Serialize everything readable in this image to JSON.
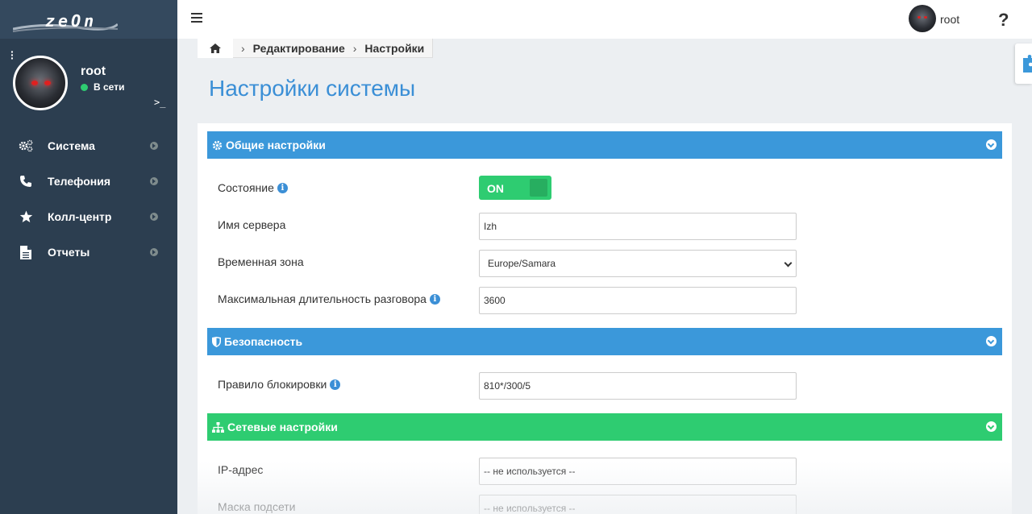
{
  "sidebar": {
    "logo_text": "zeOn",
    "user": {
      "name": "root",
      "status": "В сети"
    },
    "terminal_glyph": ">_",
    "items": [
      {
        "label": "Система",
        "icon": "gears-icon"
      },
      {
        "label": "Телефония",
        "icon": "phone-icon"
      },
      {
        "label": "Колл-центр",
        "icon": "star-icon"
      },
      {
        "label": "Отчеты",
        "icon": "document-icon"
      }
    ]
  },
  "topbar": {
    "user_name": "root",
    "help": "?"
  },
  "breadcrumb": {
    "items": [
      "Редактирование",
      "Настройки"
    ]
  },
  "page": {
    "title": "Настройки системы"
  },
  "sections": {
    "general": {
      "title": "Общие настройки",
      "state_label": "Состояние",
      "state_value": "ON",
      "server_name_label": "Имя сервера",
      "server_name_value": "Izh",
      "timezone_label": "Временная зона",
      "timezone_value": "Europe/Samara",
      "max_duration_label": "Максимальная длительность разговора",
      "max_duration_value": "3600"
    },
    "security": {
      "title": "Безопасность",
      "block_rule_label": "Правило блокировки",
      "block_rule_value": "810*/300/5"
    },
    "network": {
      "title": "Сетевые настройки",
      "ip_label": "IP-адрес",
      "ip_value": "-- не используется --",
      "mask_label": "Маска подсети",
      "mask_value": "-- не используется --"
    }
  },
  "colors": {
    "sidebar_bg": "#2c3e50",
    "accent_blue": "#3b98da",
    "accent_green": "#2ecc71",
    "title_blue": "#3b8fd6"
  }
}
